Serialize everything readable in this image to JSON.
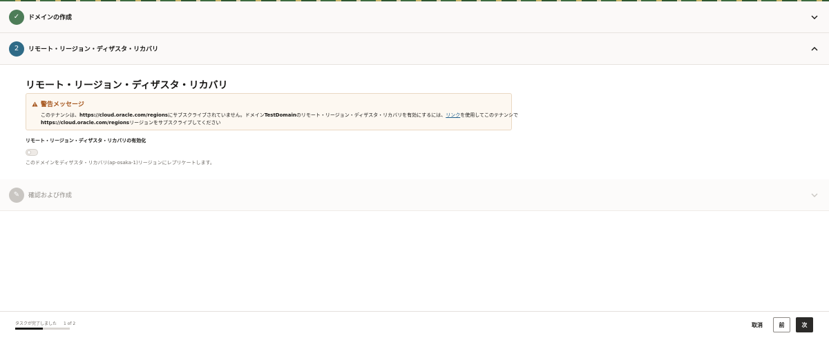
{
  "steps": [
    {
      "number": "✓",
      "title": "ドメインの作成",
      "state": "completed"
    },
    {
      "number": "2",
      "title": "リモート・リージョン・ディザスタ・リカバリ",
      "state": "active"
    },
    {
      "number": "✎",
      "title": "確認および作成",
      "state": "pending"
    }
  ],
  "section": {
    "title": "リモート・リージョン・ディザスタ・リカバリ",
    "warning": {
      "title": "警告メッセージ",
      "line1_a": "このテナンシは、",
      "line1_url": "https://cloud.oracle.com/regions",
      "line1_b": "にサブスクライブされていません。ドメイン",
      "line1_domain": "TestDomain",
      "line1_c": "のリモート・リージョン・ディザスタ・リカバリを有効にするには、",
      "line1_link": "リンク",
      "line1_d": "を使用してこのテナンシで",
      "line2_url": "https://cloud.oracle.com/regions",
      "line2_b": "リージョンをサブスクライブしてください"
    },
    "toggle_label": "リモート・リージョン・ディザスタ・リカバリの有効化",
    "toggle_state": false,
    "help_text": "このドメインをディザスタ・リカバリ(ap-osaka-1)リージョンにレプリケートします。"
  },
  "footer": {
    "progress_label": "タスクが完了しました",
    "progress_count": "1 of 2",
    "progress_fraction": 0.5,
    "cancel_label": "取消",
    "prev_label": "前",
    "next_label": "次"
  },
  "colors": {
    "completed": "#4d7d58",
    "active": "#2f6b87",
    "warning": "#a5551c"
  }
}
